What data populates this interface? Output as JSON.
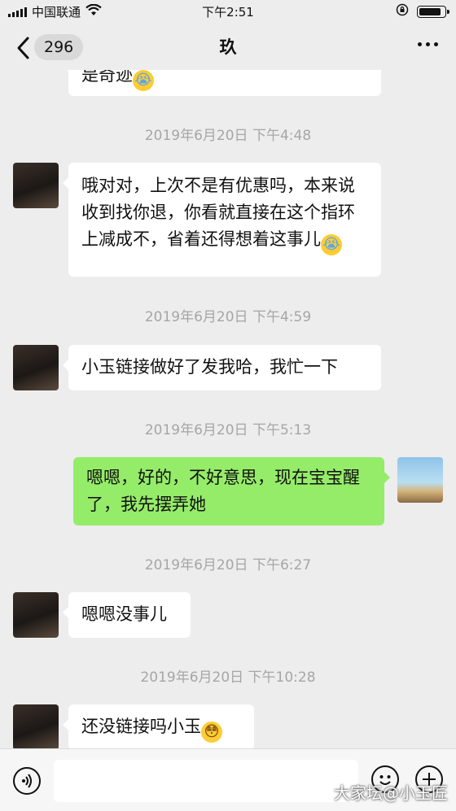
{
  "status_bar": {
    "carrier": "中国联通",
    "time": "下午2:51"
  },
  "nav": {
    "unread_count": "296",
    "title": "玖"
  },
  "messages": [
    {
      "type": "text",
      "sender": "other",
      "text": "是奇迹",
      "emoji": "😭"
    },
    {
      "type": "timestamp",
      "text": "2019年6月20日 下午4:48"
    },
    {
      "type": "text",
      "sender": "other",
      "text": "哦对对，上次不是有优惠吗，本来说收到找你退，你看就直接在这个指环上减成不，省着还得想着这事儿",
      "emoji": "😭"
    },
    {
      "type": "timestamp",
      "text": "2019年6月20日 下午4:59"
    },
    {
      "type": "text",
      "sender": "other",
      "text": "小玉链接做好了发我哈，我忙一下"
    },
    {
      "type": "timestamp",
      "text": "2019年6月20日 下午5:13"
    },
    {
      "type": "text",
      "sender": "me",
      "text": "嗯嗯，好的，不好意思，现在宝宝醒了，我先摆弄她"
    },
    {
      "type": "timestamp",
      "text": "2019年6月20日 下午6:27"
    },
    {
      "type": "text",
      "sender": "other",
      "text": "嗯嗯没事儿"
    },
    {
      "type": "timestamp",
      "text": "2019年6月20日 下午10:28"
    },
    {
      "type": "text",
      "sender": "other",
      "text": "还没链接吗小玉",
      "emoji": "😳"
    }
  ],
  "input_bar": {
    "voice_icon": "voice-icon",
    "emoji_icon": "emoji-icon",
    "plus_icon": "plus-icon",
    "watermark": "大家坛@小玉匠"
  },
  "colors": {
    "background": "#ededed",
    "my_bubble": "#95ec69",
    "their_bubble": "#ffffff"
  }
}
